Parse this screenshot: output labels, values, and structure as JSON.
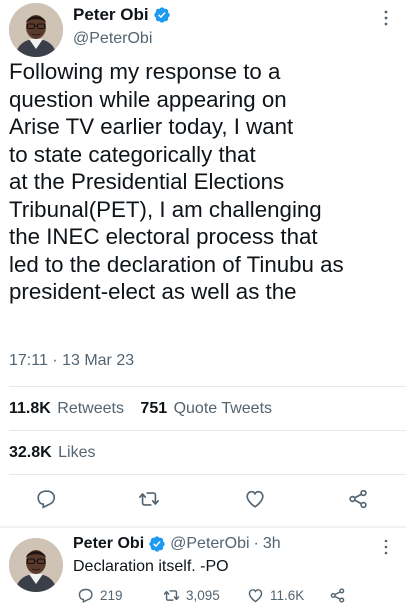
{
  "tweet": {
    "author": {
      "name": "Peter Obi",
      "handle": "@PeterObi"
    },
    "text": "Following my response to a\nquestion while appearing on\nArise TV earlier today, I want\nto state categorically that\nat the Presidential Elections\nTribunal(PET), I am challenging\nthe INEC electoral process that\nled to the declaration of Tinubu as\npresident-elect as well as the",
    "timestamp": "17:11 · 13 Mar 23",
    "stats": {
      "retweets_count": "11.8K",
      "retweets_label": "Retweets",
      "quote_count": "751",
      "quote_label": "Quote Tweets",
      "likes_count": "32.8K",
      "likes_label": "Likes"
    },
    "actions": [
      "reply-icon",
      "retweet-icon",
      "like-icon",
      "share-icon"
    ]
  },
  "reply": {
    "author": {
      "name": "Peter Obi",
      "handle": "@PeterObi",
      "separator": "·",
      "time": "3h"
    },
    "text": "Declaration itself. -PO",
    "counts": {
      "replies": "219",
      "retweets": "3,095",
      "likes": "11.6K"
    }
  },
  "colors": {
    "text": "#0f1419",
    "muted": "#536471",
    "verified": "#1d9bf0",
    "divider": "#e6e9ec"
  }
}
